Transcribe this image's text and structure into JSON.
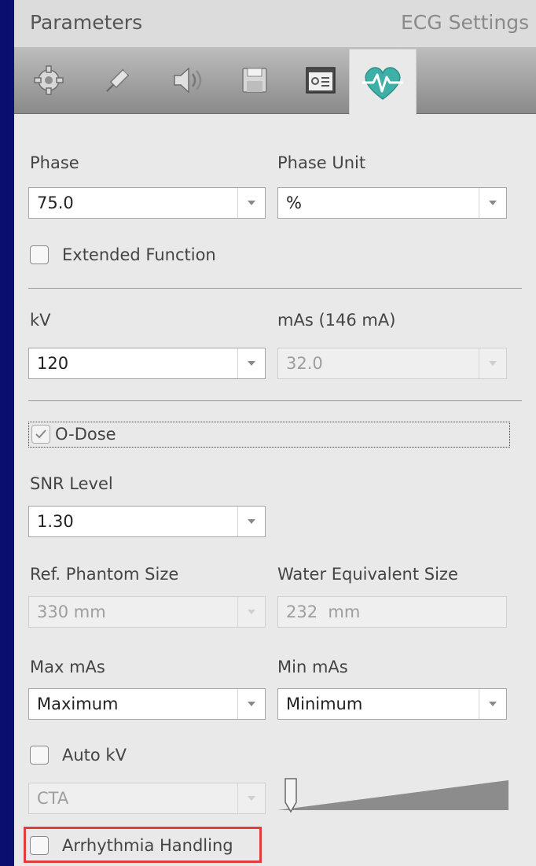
{
  "header": {
    "title": "Parameters",
    "right_label": "ECG Settings"
  },
  "toolbar": {
    "buttons": [
      {
        "icon": "gear-icon"
      },
      {
        "icon": "syringe-icon"
      },
      {
        "icon": "speaker-icon"
      },
      {
        "icon": "floppy-disk-icon"
      },
      {
        "icon": "scan-settings-icon"
      },
      {
        "icon": "heart-ecg-icon",
        "active": true
      }
    ]
  },
  "phase": {
    "label": "Phase",
    "value": "75.0"
  },
  "phase_unit": {
    "label": "Phase Unit",
    "value": "%"
  },
  "extended_function": {
    "label": "Extended Function",
    "checked": false
  },
  "kv": {
    "label": "kV",
    "value": "120"
  },
  "mas": {
    "label": "mAs (146 mA)",
    "value": "32.0"
  },
  "odose": {
    "label": "O-Dose",
    "checked": true
  },
  "snr": {
    "label": "SNR Level",
    "value": "1.30"
  },
  "ref_phantom": {
    "label": "Ref. Phantom Size",
    "value": "330 mm"
  },
  "water_equiv": {
    "label": "Water Equivalent Size",
    "value": "232  mm"
  },
  "max_mas": {
    "label": "Max mAs",
    "value": "Maximum"
  },
  "min_mas": {
    "label": "Min mAs",
    "value": "Minimum"
  },
  "auto_kv": {
    "label": "Auto kV",
    "checked": false
  },
  "kv_mode": {
    "value": "CTA"
  },
  "kv_slider": {
    "position": 0.0
  },
  "arrhythmia": {
    "label": "Arrhythmia Handling",
    "checked": false
  },
  "colors": {
    "highlight": "#e23d3d",
    "ecg_teal": "#3fb0a8",
    "background": "#0a0f6e"
  }
}
